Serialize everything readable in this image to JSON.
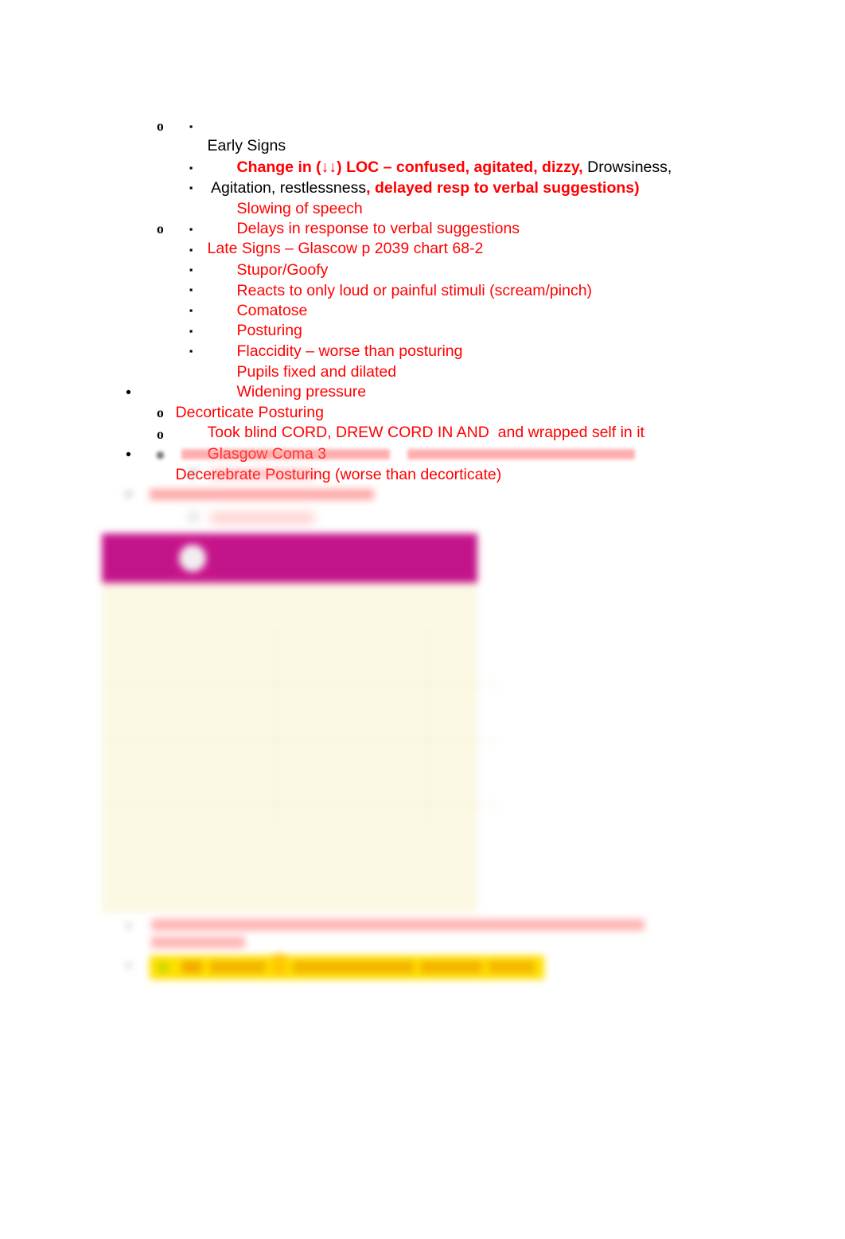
{
  "document": {
    "type": "study-notes-outline",
    "colors": {
      "red": "#FF0000",
      "black": "#000000",
      "magenta_banner": "#C8158C",
      "figure_background": "#FBF8E3",
      "yellow_highlight": "#FFE000"
    }
  },
  "outline": {
    "early_signs": {
      "label": "Early Signs",
      "marker": "o",
      "items": [
        {
          "marker": "▪",
          "segments": [
            {
              "text": "Change in (↓↓) LOC – confused, agitated, dizzy,",
              "color": "red",
              "bold": true
            },
            {
              "text": " Drowsiness, Agitation, restlessness",
              "color": "black",
              "bold": false
            },
            {
              "text": ", delayed resp to verbal suggestions)",
              "color": "red",
              "bold": true
            }
          ]
        },
        {
          "marker": "▪",
          "text": "Slowing of speech",
          "color": "red"
        },
        {
          "marker": "▪",
          "text": "Delays in response to verbal suggestions",
          "color": "red"
        }
      ]
    },
    "late_signs": {
      "label": "Late Signs – Glascow p 2039 chart 68-2",
      "marker": "o",
      "items": [
        {
          "marker": "▪",
          "text": "Stupor/Goofy"
        },
        {
          "marker": "▪",
          "text": "Reacts to only loud or painful stimuli (scream/pinch)"
        },
        {
          "marker": "▪",
          "text": "Comatose"
        },
        {
          "marker": "▪",
          "text": "Posturing"
        },
        {
          "marker": "▪",
          "text": "Flaccidity – worse than posturing"
        },
        {
          "marker": "▪",
          "text": "Pupils fixed and dilated"
        },
        {
          "marker": "▪",
          "text": "Widening pressure"
        }
      ]
    },
    "decorticate": {
      "marker": "•",
      "label": "Decorticate Posturing",
      "items": [
        {
          "marker": "o",
          "text": "Took blind CORD, DREW CORD IN AND  and wrapped self in it"
        },
        {
          "marker": "o",
          "text": "Glasgow Coma 3"
        }
      ]
    },
    "decerebrate": {
      "marker": "•",
      "label": "Decerebrate Posturing (worse than decorticate)",
      "items": [
        {
          "marker": "o",
          "text": "",
          "blurred": true
        },
        {
          "marker": "▪",
          "text": "",
          "blurred": true
        }
      ]
    },
    "blurred_block": {
      "note": "illegible",
      "rows": [
        {
          "marker": "o",
          "text": "",
          "blurred": true
        },
        {
          "marker": "▪",
          "text": "",
          "blurred": true
        }
      ]
    }
  },
  "figure": {
    "header": {
      "left_label": "",
      "right_label": "",
      "avatar": "avatar-circle"
    },
    "title": "",
    "subtitle": "",
    "table": {
      "rows": [
        {
          "category": "",
          "responses": "",
          "score": ""
        },
        {
          "category": "",
          "responses": "",
          "score": ""
        },
        {
          "category": "",
          "responses": "",
          "score": ""
        },
        {
          "category": "",
          "responses": "",
          "score": ""
        }
      ]
    },
    "blurred": true
  },
  "tail": {
    "lines": [
      {
        "marker": "o",
        "text": "",
        "blurred": true
      },
      {
        "marker": "▪",
        "text": "",
        "blurred": true,
        "highlight": "yellow"
      }
    ]
  }
}
